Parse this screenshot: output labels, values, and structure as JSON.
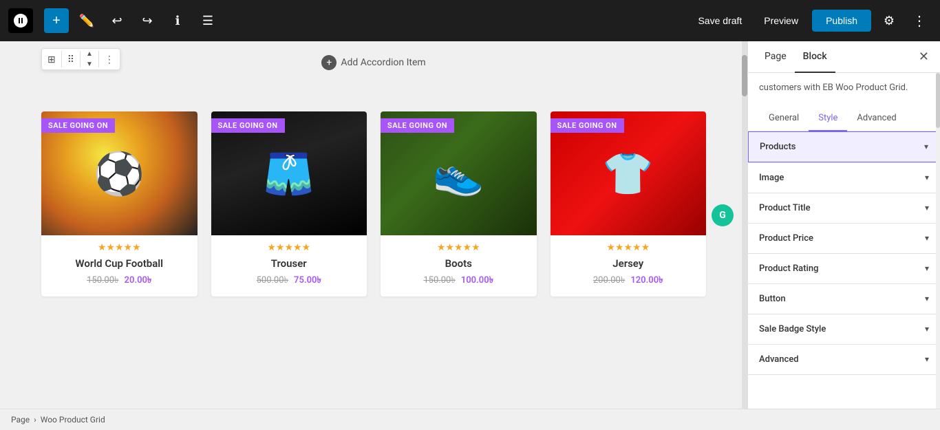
{
  "toolbar": {
    "add_label": "+",
    "save_draft_label": "Save draft",
    "preview_label": "Preview",
    "publish_label": "Publish"
  },
  "block_toolbar": {
    "grid_icon": "⊞",
    "drag_icon": "⠿",
    "up_icon": "▲",
    "down_icon": "▼",
    "more_icon": "⋮"
  },
  "editor": {
    "add_accordion_label": "Add Accordion Item"
  },
  "products": [
    {
      "id": 1,
      "title": "World Cup Football",
      "original_price": "150.00৳",
      "sale_price": "20.00৳",
      "sale_badge": "SALE GOING ON",
      "stars": 5,
      "image_type": "ball"
    },
    {
      "id": 2,
      "title": "Trouser",
      "original_price": "500.00৳",
      "sale_price": "75.00৳",
      "sale_badge": "SALE GOING ON",
      "stars": 5,
      "image_type": "shorts"
    },
    {
      "id": 3,
      "title": "Boots",
      "original_price": "150.00৳",
      "sale_price": "100.00৳",
      "sale_badge": "SALE GOING ON",
      "stars": 5,
      "image_type": "boots"
    },
    {
      "id": 4,
      "title": "Jersey",
      "original_price": "200.00৳",
      "sale_price": "120.00৳",
      "sale_badge": "SALE GOING ON",
      "stars": 5,
      "image_type": "jersey"
    }
  ],
  "sidebar": {
    "tab_page": "Page",
    "tab_block": "Block",
    "desc_text": "customers with EB Woo Product Grid.",
    "style_tabs": [
      {
        "id": "general",
        "label": "General"
      },
      {
        "id": "style",
        "label": "Style"
      },
      {
        "id": "advanced",
        "label": "Advanced"
      }
    ],
    "accordion_items": [
      {
        "id": "products",
        "label": "Products",
        "active": true
      },
      {
        "id": "image",
        "label": "Image",
        "active": false
      },
      {
        "id": "product-title",
        "label": "Product Title",
        "active": false
      },
      {
        "id": "product-price",
        "label": "Product Price",
        "active": false
      },
      {
        "id": "product-rating",
        "label": "Product Rating",
        "active": false
      },
      {
        "id": "button",
        "label": "Button",
        "active": false
      },
      {
        "id": "sale-badge",
        "label": "Sale Badge Style",
        "active": false
      },
      {
        "id": "advanced",
        "label": "Advanced",
        "active": false
      }
    ]
  },
  "breadcrumb": {
    "page_label": "Page",
    "separator": "›",
    "current": "Woo Product Grid"
  },
  "colors": {
    "purple": "#a855f7",
    "blue": "#007cba",
    "star_gold": "#f5a623",
    "active_purple": "#7b68ee"
  }
}
